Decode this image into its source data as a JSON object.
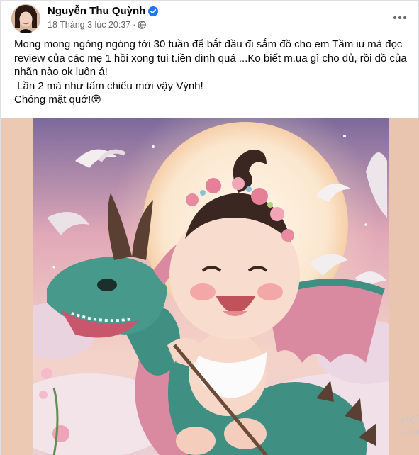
{
  "post": {
    "author": "Nguyễn Thu Quỳnh",
    "timestamp": "18 Tháng 3 lúc 20:37",
    "dot": "·",
    "lines": [
      "Mong mong ngóng ngóng tới 30 tuần để bắt đầu đi sắm đồ cho em Tầm iu mà đọc review của các mẹ 1 hồi xong tui t.iền đình quá ...Ko biết m.ua gì cho đủ, rồi đồ của nhãn nào ok luôn á!",
      " Lần 2 mà như tấm chiếu mới vậy Vỳnh!",
      "Chóng mặt quớ!"
    ],
    "emoji": "😵"
  },
  "icons": {
    "verified": "verified-badge-icon",
    "privacy": "globe-icon",
    "more": "more-options-icon"
  },
  "watermark": {
    "line1": "Acti",
    "line2": "Go to"
  },
  "colors": {
    "text": "#050505",
    "meta": "#65676b",
    "verified": "#1877f2",
    "border": "#dddfe2"
  }
}
